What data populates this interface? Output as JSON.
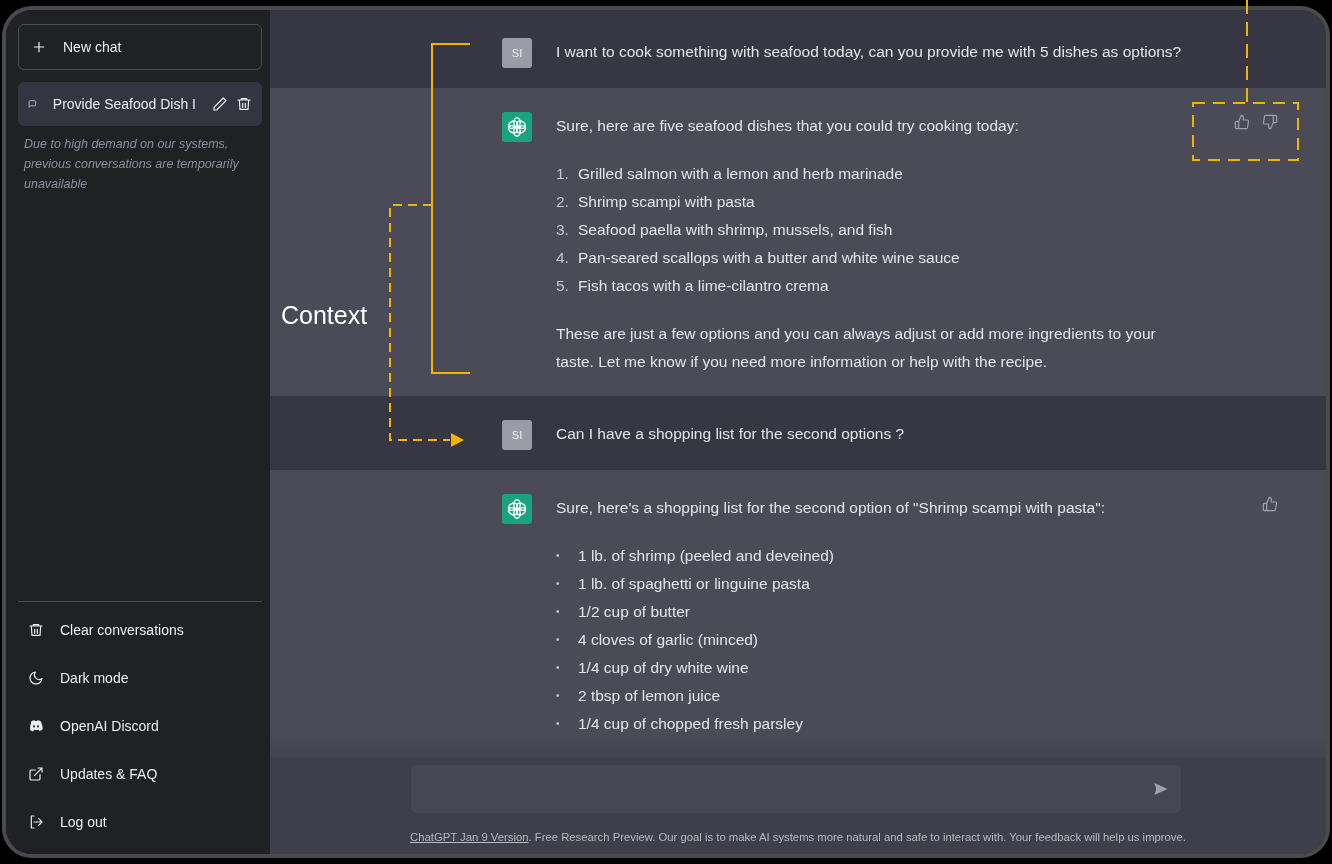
{
  "sidebar": {
    "new_chat": "New chat",
    "conversations": [
      {
        "title": "Provide Seafood Dish I",
        "selected": true
      }
    ],
    "notice": "Due to high demand on our systems, previous conversations are temporarily unavailable",
    "menu": [
      {
        "kind": "trash",
        "label": "Clear conversations"
      },
      {
        "kind": "moon",
        "label": "Dark mode"
      },
      {
        "kind": "controller",
        "label": "OpenAI Discord"
      },
      {
        "kind": "external",
        "label": "Updates & FAQ"
      },
      {
        "kind": "logout",
        "label": "Log out"
      }
    ]
  },
  "messages": [
    {
      "kind": "user",
      "avatar": "SI",
      "blocks": [
        {
          "kind": "paragraph",
          "text": "I want to cook something with seafood today, can you provide me with 5 dishes as options?"
        }
      ]
    },
    {
      "kind": "assistant",
      "feedback": [
        {
          "kind": "up"
        },
        {
          "kind": "down"
        }
      ],
      "blocks": [
        {
          "kind": "paragraph",
          "text": "Sure, here are five seafood dishes that you could try cooking today:"
        },
        {
          "kind": "list",
          "items": [
            {
              "marker": "1.",
              "text": "Grilled salmon with a lemon and herb marinade"
            },
            {
              "marker": "2.",
              "text": "Shrimp scampi with pasta"
            },
            {
              "marker": "3.",
              "text": "Seafood paella with shrimp, mussels, and fish"
            },
            {
              "marker": "4.",
              "text": "Pan-seared scallops with a butter and white wine sauce"
            },
            {
              "marker": "5.",
              "text": "Fish tacos with a lime-cilantro crema"
            }
          ]
        },
        {
          "kind": "paragraph",
          "text": "These are just a few options and you can always adjust or add more ingredients to your taste. Let me know if you need more information or help with the recipe."
        }
      ]
    },
    {
      "kind": "user",
      "avatar": "SI",
      "blocks": [
        {
          "kind": "paragraph",
          "text": "Can I have a shopping list for the second options ?"
        }
      ]
    },
    {
      "kind": "assistant",
      "feedback": [
        {
          "kind": "up"
        }
      ],
      "blocks": [
        {
          "kind": "paragraph",
          "text": "Sure, here's a shopping list for the second option of \"Shrimp scampi with pasta\":"
        },
        {
          "kind": "list",
          "items": [
            {
              "marker": "•",
              "text": "1 lb. of shrimp (peeled and deveined)"
            },
            {
              "marker": "•",
              "text": "1 lb. of spaghetti or linguine pasta"
            },
            {
              "marker": "•",
              "text": "1/2 cup of butter"
            },
            {
              "marker": "•",
              "text": "4 cloves of garlic (minced)"
            },
            {
              "marker": "•",
              "text": "1/4 cup of dry white wine"
            },
            {
              "marker": "•",
              "text": "2 tbsp of lemon juice"
            },
            {
              "marker": "•",
              "text": "1/4 cup of chopped fresh parsley"
            }
          ]
        }
      ]
    }
  ],
  "footer": {
    "link": "ChatGPT Jan 9 Version",
    "text": ". Free Research Preview. Our goal is to make AI systems more natural and safe to interact with. Your feedback will help us improve."
  },
  "annotation": {
    "label": "Context"
  }
}
